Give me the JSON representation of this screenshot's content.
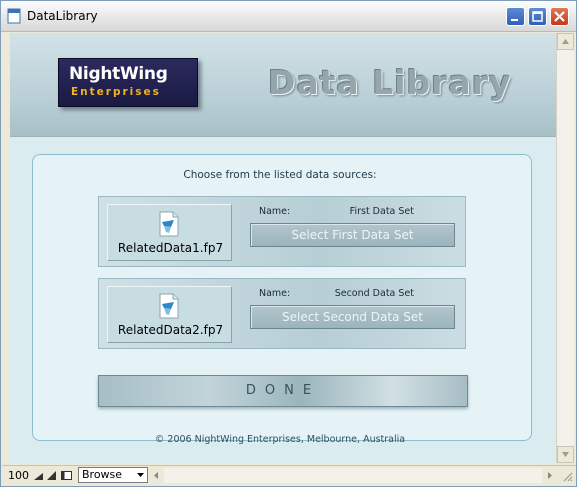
{
  "window": {
    "title": "DataLibrary"
  },
  "header": {
    "logo_line1": "NightWing",
    "logo_line2": "Enterprises",
    "app_title": "Data Library"
  },
  "main": {
    "instruction": "Choose from the listed data sources:",
    "sources": [
      {
        "file_name": "RelatedData1.fp7",
        "name_label": "Name:",
        "name_value": "First Data Set",
        "button_label": "Select First Data Set"
      },
      {
        "file_name": "RelatedData2.fp7",
        "name_label": "Name:",
        "name_value": "Second Data Set",
        "button_label": "Select Second Data Set"
      }
    ],
    "done_label": "DONE",
    "copyright": "© 2006  NightWing Enterprises, Melbourne, Australia"
  },
  "statusbar": {
    "zoom": "100",
    "mode": "Browse"
  },
  "icons": {
    "file": "document-icon",
    "app": "app-window-icon"
  },
  "colors": {
    "logo_bg": "#1f1f4f",
    "logo_accent": "#f2b31b",
    "panel_border": "#8fbdd0",
    "title_text": "#96a6ad"
  }
}
